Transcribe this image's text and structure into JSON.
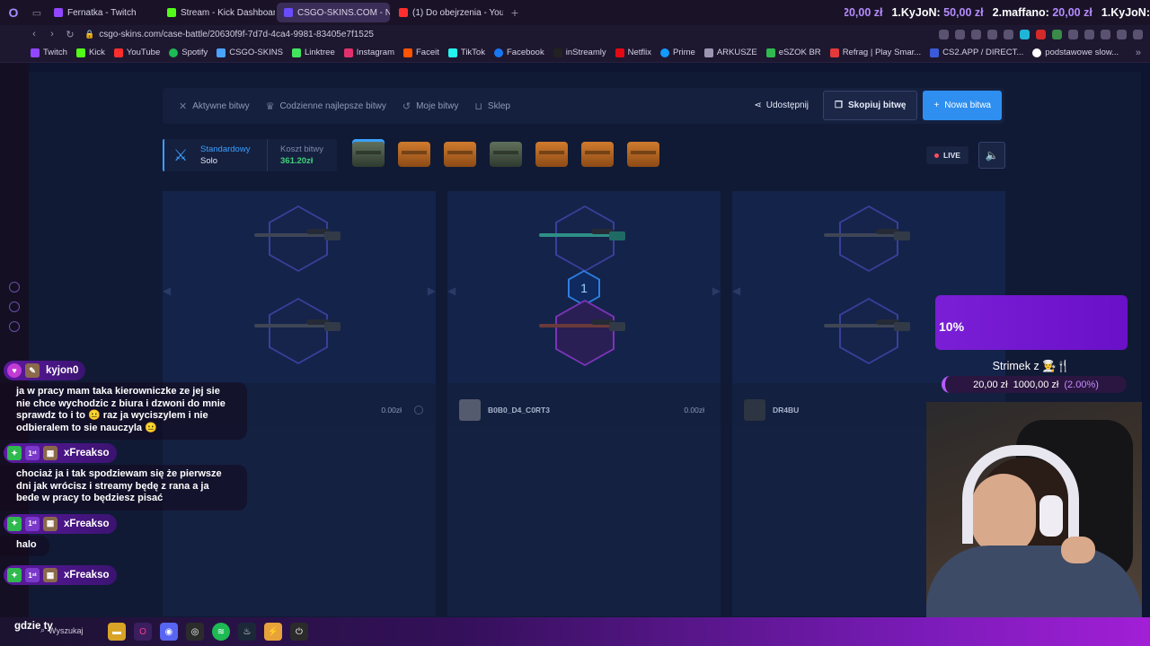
{
  "browser": {
    "tabs": [
      {
        "label": "Fernatka - Twitch",
        "color": "#9146ff",
        "active": false
      },
      {
        "label": "Stream - Kick Dashboard",
        "color": "#53fc18",
        "active": false
      },
      {
        "label": "CSGO-SKINS.COM - N",
        "color": "#6a4cff",
        "active": true
      },
      {
        "label": "(1) Do obejrzenia - YouTube",
        "color": "#ff2e2e",
        "active": false
      }
    ],
    "url": "csgo-skins.com/case-battle/20630f9f-7d7d-4ca4-9981-83405e7f1525",
    "ticker": [
      {
        "name": "ю:",
        "amount": "20,00 zł"
      },
      {
        "name": "1.KyJoN:",
        "amount": "50,00 zł"
      },
      {
        "name": "2.maffano:",
        "amount": "20,00 zł"
      },
      {
        "name": "1.KyJoN:",
        "amount": ""
      }
    ],
    "bookmarks": [
      {
        "label": "Twitch",
        "color": "#9146ff"
      },
      {
        "label": "Kick",
        "color": "#53fc18"
      },
      {
        "label": "YouTube",
        "color": "#ff2e2e"
      },
      {
        "label": "Spotify",
        "color": "#1db954"
      },
      {
        "label": "CSGO-SKINS",
        "color": "#4aa3ff"
      },
      {
        "label": "Linktree",
        "color": "#43e55e"
      },
      {
        "label": "Instagram",
        "color": "#e1306c"
      },
      {
        "label": "Faceit",
        "color": "#ff5500"
      },
      {
        "label": "TikTok",
        "color": "#25f4ee"
      },
      {
        "label": "Facebook",
        "color": "#1877f2"
      },
      {
        "label": "inStreamly",
        "color": "#222222"
      },
      {
        "label": "Netflix",
        "color": "#e50914"
      },
      {
        "label": "Prime",
        "color": "#1399ff"
      },
      {
        "label": "ARKUSZE",
        "color": "#9d96b3"
      },
      {
        "label": "eSZOK BR",
        "color": "#2fb94e"
      },
      {
        "label": "Refrag | Play Smar...",
        "color": "#e23a3a"
      },
      {
        "label": "CS2.APP / DIRECT...",
        "color": "#3a5bd9"
      },
      {
        "label": "podstawowe slow...",
        "color": "#ffffff"
      }
    ]
  },
  "subnav": {
    "items": [
      {
        "label": "Aktywne bitwy",
        "icon": "swords-icon"
      },
      {
        "label": "Codzienne najlepsze bitwy",
        "icon": "trophy-icon"
      },
      {
        "label": "Moje bitwy",
        "icon": "history-icon"
      },
      {
        "label": "Sklep",
        "icon": "basket-icon"
      }
    ],
    "share_label": "Udostępnij",
    "copy_label": "Skopiuj bitwę",
    "new_label": "Nowa bitwa"
  },
  "battle": {
    "mode_line1": "Standardowy",
    "mode_line2": "Solo",
    "cost_label": "Koszt bitwy",
    "cost_value": "361.20zł",
    "live_label": "LIVE",
    "round_number": "1",
    "players": [
      {
        "name": "",
        "value": "0.00zł"
      },
      {
        "name": "B0B0_D4_C0RT3",
        "value": "0.00zł"
      },
      {
        "name": "DR4BU",
        "value": ""
      }
    ]
  },
  "chat": [
    {
      "user": "kyjon0",
      "text": "ja w pracy mam taka kierowniczke ze jej sie nie chce wychodzic z biura i dzwoni do mnie sprawdz to i to 😐 raz ja wyciszylem i nie odbieralem to sie nauczyla 😐"
    },
    {
      "user": "xFreakso",
      "text": "chociaż ja i tak spodziewam się że pierwsze dni jak wrócisz i streamy będę z rana a ja bede w pracy to będziesz pisać"
    },
    {
      "user": "xFreakso",
      "text": "halo"
    },
    {
      "user": "xFreakso",
      "text": ""
    }
  ],
  "chat_partial": "gdzie ty",
  "goal": {
    "percent_label": "10%",
    "title": "Strimek z 👨‍🍳🍴",
    "current": "20,00 zł",
    "target": "1000,00 zł",
    "percent": "(2.00%)"
  },
  "taskbar": {
    "search_label": "Wyszukaj"
  }
}
